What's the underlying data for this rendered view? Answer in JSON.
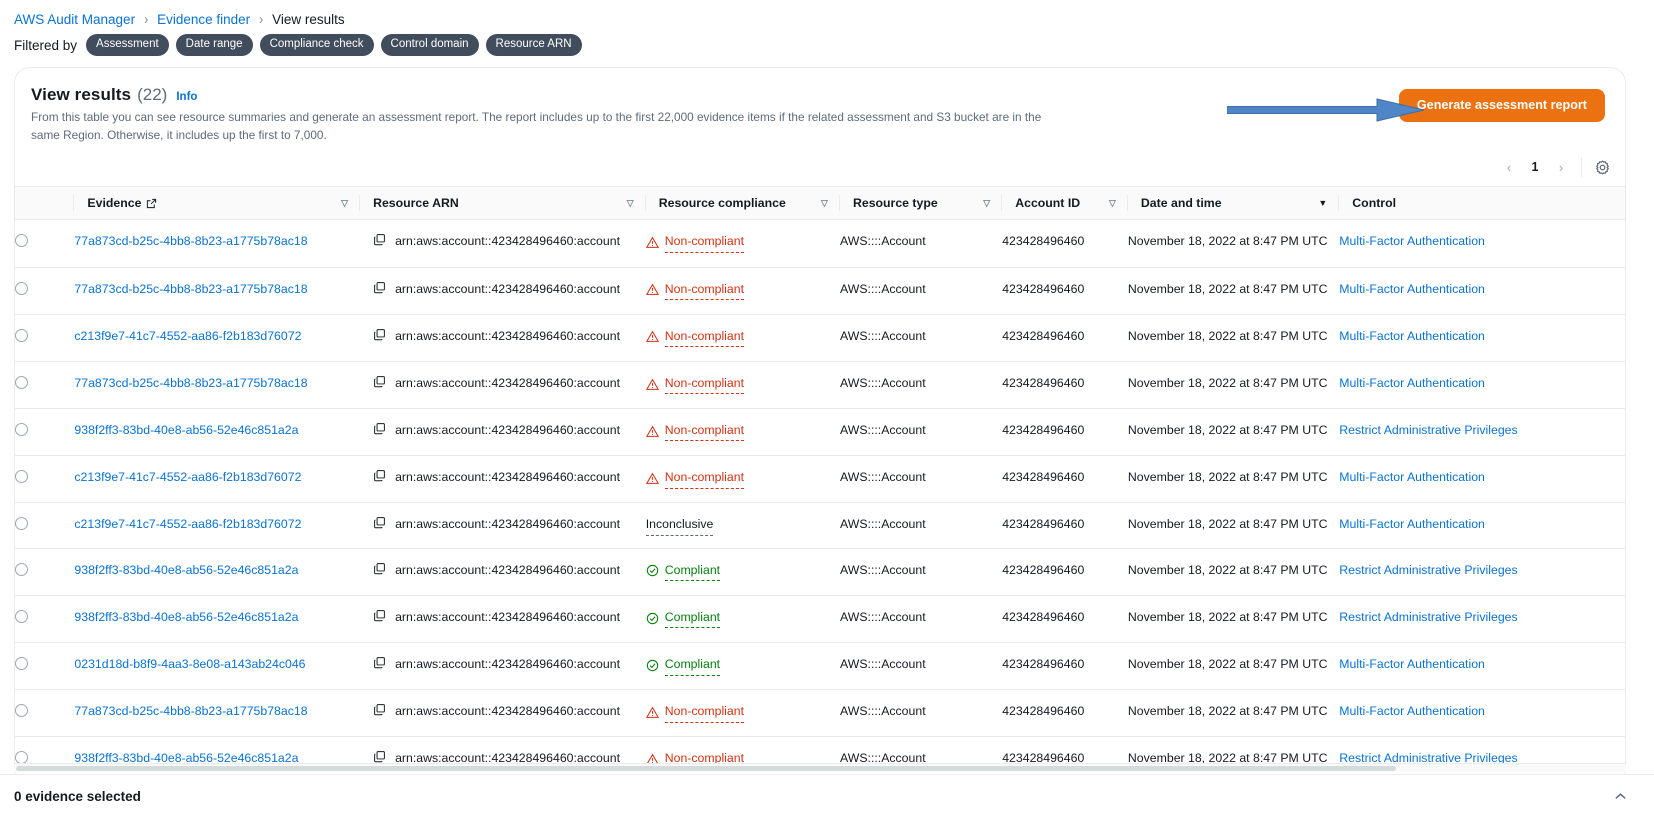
{
  "breadcrumb": {
    "items": [
      {
        "label": "AWS Audit Manager",
        "current": false
      },
      {
        "label": "Evidence finder",
        "current": false
      },
      {
        "label": "View results",
        "current": true
      }
    ],
    "separator": "›"
  },
  "filters": {
    "label": "Filtered by",
    "pills": [
      "Assessment",
      "Date range",
      "Compliance check",
      "Control domain",
      "Resource ARN"
    ]
  },
  "header": {
    "title": "View results",
    "count": "(22)",
    "info_label": "Info",
    "description": "From this table you can see resource summaries and generate an assessment report. The report includes up to the first 22,000 evidence items if the related assessment and S3 bucket are in the same Region. Otherwise, it includes up the first to 7,000.",
    "primary_button": "Generate assessment report",
    "primary_button_color": "#ec7211",
    "annotation_arrow_color": "#4e86c7"
  },
  "pagination": {
    "prev": "‹",
    "page": "1",
    "next": "›",
    "settings_icon": "gear-icon"
  },
  "table": {
    "columns": [
      {
        "key": "evidence",
        "label": "Evidence",
        "icon": "external-link-icon",
        "sort": "hollow"
      },
      {
        "key": "arn",
        "label": "Resource ARN",
        "sort": "hollow"
      },
      {
        "key": "compliance",
        "label": "Resource compliance",
        "sort": "hollow"
      },
      {
        "key": "type",
        "label": "Resource type",
        "sort": "hollow"
      },
      {
        "key": "account",
        "label": "Account ID",
        "sort": "hollow"
      },
      {
        "key": "date",
        "label": "Date and time",
        "sort": "active"
      },
      {
        "key": "control",
        "label": "Control",
        "sort": "none"
      }
    ],
    "rows": [
      {
        "evidence": "77a873cd-b25c-4bb8-8b23-a1775b78ac18",
        "arn": "arn:aws:account::423428496460:account",
        "compliance": "Non-compliant",
        "compliance_state": "non",
        "type": "AWS::::Account",
        "account": "423428496460",
        "date": "November 18, 2022 at 8:47 PM UTC",
        "control": "Multi-Factor Authentication"
      },
      {
        "evidence": "77a873cd-b25c-4bb8-8b23-a1775b78ac18",
        "arn": "arn:aws:account::423428496460:account",
        "compliance": "Non-compliant",
        "compliance_state": "non",
        "type": "AWS::::Account",
        "account": "423428496460",
        "date": "November 18, 2022 at 8:47 PM UTC",
        "control": "Multi-Factor Authentication"
      },
      {
        "evidence": "c213f9e7-41c7-4552-aa86-f2b183d76072",
        "arn": "arn:aws:account::423428496460:account",
        "compliance": "Non-compliant",
        "compliance_state": "non",
        "type": "AWS::::Account",
        "account": "423428496460",
        "date": "November 18, 2022 at 8:47 PM UTC",
        "control": "Multi-Factor Authentication"
      },
      {
        "evidence": "77a873cd-b25c-4bb8-8b23-a1775b78ac18",
        "arn": "arn:aws:account::423428496460:account",
        "compliance": "Non-compliant",
        "compliance_state": "non",
        "type": "AWS::::Account",
        "account": "423428496460",
        "date": "November 18, 2022 at 8:47 PM UTC",
        "control": "Multi-Factor Authentication"
      },
      {
        "evidence": "938f2ff3-83bd-40e8-ab56-52e46c851a2a",
        "arn": "arn:aws:account::423428496460:account",
        "compliance": "Non-compliant",
        "compliance_state": "non",
        "type": "AWS::::Account",
        "account": "423428496460",
        "date": "November 18, 2022 at 8:47 PM UTC",
        "control": "Restrict Administrative Privileges"
      },
      {
        "evidence": "c213f9e7-41c7-4552-aa86-f2b183d76072",
        "arn": "arn:aws:account::423428496460:account",
        "compliance": "Non-compliant",
        "compliance_state": "non",
        "type": "AWS::::Account",
        "account": "423428496460",
        "date": "November 18, 2022 at 8:47 PM UTC",
        "control": "Multi-Factor Authentication"
      },
      {
        "evidence": "c213f9e7-41c7-4552-aa86-f2b183d76072",
        "arn": "arn:aws:account::423428496460:account",
        "compliance": "Inconclusive",
        "compliance_state": "inc",
        "type": "AWS::::Account",
        "account": "423428496460",
        "date": "November 18, 2022 at 8:47 PM UTC",
        "control": "Multi-Factor Authentication"
      },
      {
        "evidence": "938f2ff3-83bd-40e8-ab56-52e46c851a2a",
        "arn": "arn:aws:account::423428496460:account",
        "compliance": "Compliant",
        "compliance_state": "ok",
        "type": "AWS::::Account",
        "account": "423428496460",
        "date": "November 18, 2022 at 8:47 PM UTC",
        "control": "Restrict Administrative Privileges"
      },
      {
        "evidence": "938f2ff3-83bd-40e8-ab56-52e46c851a2a",
        "arn": "arn:aws:account::423428496460:account",
        "compliance": "Compliant",
        "compliance_state": "ok",
        "type": "AWS::::Account",
        "account": "423428496460",
        "date": "November 18, 2022 at 8:47 PM UTC",
        "control": "Restrict Administrative Privileges"
      },
      {
        "evidence": "0231d18d-b8f9-4aa3-8e08-a143ab24c046",
        "arn": "arn:aws:account::423428496460:account",
        "compliance": "Compliant",
        "compliance_state": "ok",
        "type": "AWS::::Account",
        "account": "423428496460",
        "date": "November 18, 2022 at 8:47 PM UTC",
        "control": "Multi-Factor Authentication"
      },
      {
        "evidence": "77a873cd-b25c-4bb8-8b23-a1775b78ac18",
        "arn": "arn:aws:account::423428496460:account",
        "compliance": "Non-compliant",
        "compliance_state": "non",
        "type": "AWS::::Account",
        "account": "423428496460",
        "date": "November 18, 2022 at 8:47 PM UTC",
        "control": "Multi-Factor Authentication"
      },
      {
        "evidence": "938f2ff3-83bd-40e8-ab56-52e46c851a2a",
        "arn": "arn:aws:account::423428496460:account",
        "compliance": "Non-compliant",
        "compliance_state": "non",
        "type": "AWS::::Account",
        "account": "423428496460",
        "date": "November 18, 2022 at 8:47 PM UTC",
        "control": "Restrict Administrative Privileges"
      }
    ]
  },
  "footer": {
    "selection_text": "0 evidence selected",
    "collapse_icon": "chevron-up-icon"
  },
  "colors": {
    "link": "#0972d3",
    "non_compliant": "#d13212",
    "compliant": "#037f0c",
    "pill_bg": "#414d5c"
  }
}
